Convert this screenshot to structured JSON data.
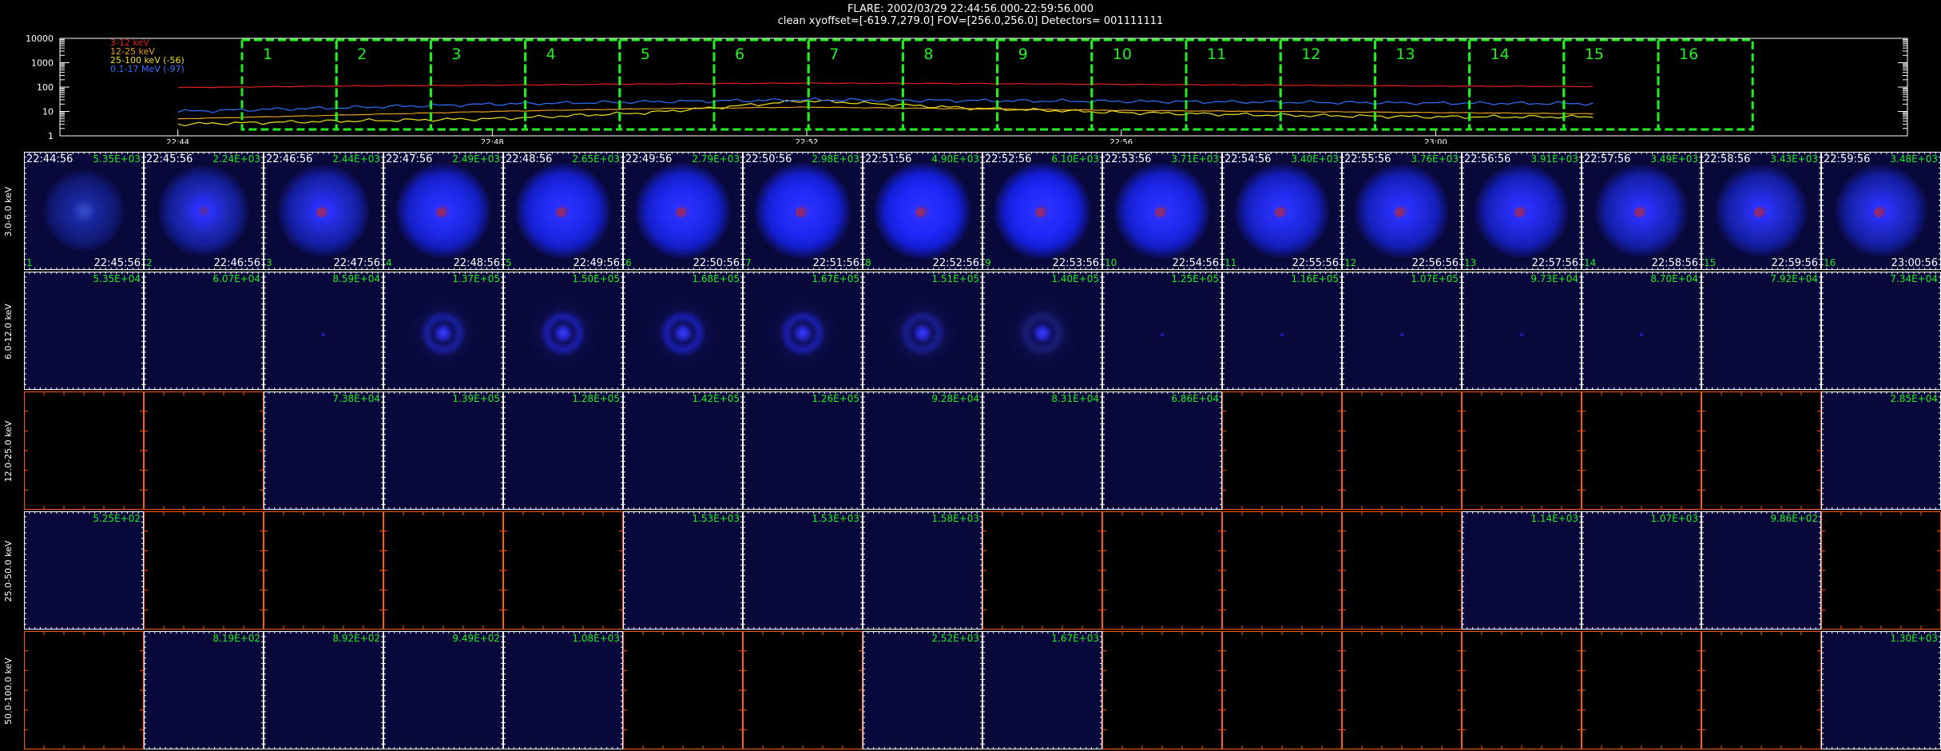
{
  "header": {
    "line1": "FLARE: 2002/03/29 22:44:56.000-22:59:56.000",
    "line2": "clean    xyoffset=[-619.7,279.0]    FOV=[256.0,256.0]    Detectors= 001111111"
  },
  "lightcurve": {
    "y_ticks": [
      "10000",
      "1000",
      "100",
      "10",
      "1"
    ],
    "x_ticks": [
      "22:44",
      "22:48",
      "22:52",
      "22:56",
      "23:00"
    ],
    "legend": [
      {
        "label": "3-12 keV",
        "color": "#e02020"
      },
      {
        "label": "12-25 keV",
        "color": "#e8a020"
      },
      {
        "label": "25-100 keV (-56)",
        "color": "#f0e020"
      },
      {
        "label": "0.1-17 MeV (-97)",
        "color": "#3070ff"
      }
    ],
    "interval_labels": [
      "1",
      "2",
      "3",
      "4",
      "5",
      "6",
      "7",
      "8",
      "9",
      "10",
      "11",
      "12",
      "13",
      "14",
      "15",
      "16"
    ],
    "interval_color": "#22ee22"
  },
  "chart_data": {
    "type": "line",
    "yscale": "log",
    "ylim": [
      1,
      10000
    ],
    "xlim": [
      "22:42:30",
      "23:06:00"
    ],
    "x": [
      "22:44:00",
      "22:46:00",
      "22:48:00",
      "22:50:00",
      "22:52:00",
      "22:54:00",
      "22:56:00",
      "22:58:00",
      "23:00:00",
      "23:02:00"
    ],
    "series": [
      {
        "name": "3-12 keV",
        "color": "#e02020",
        "values": [
          95,
          110,
          120,
          135,
          145,
          140,
          130,
          120,
          110,
          105
        ]
      },
      {
        "name": "12-25 keV",
        "color": "#e8a020",
        "values": [
          5,
          7,
          10,
          13,
          15,
          13,
          11,
          10,
          9,
          8
        ]
      },
      {
        "name": "25-100 keV (-56)",
        "color": "#f0e020",
        "values": [
          3,
          4,
          5,
          9,
          28,
          14,
          9,
          7,
          6,
          6
        ]
      },
      {
        "name": "0.1-17 MeV (-97)",
        "color": "#3070ff",
        "values": [
          10,
          14,
          20,
          25,
          30,
          28,
          26,
          24,
          22,
          21
        ]
      }
    ]
  },
  "grid": {
    "row_labels": [
      "3.0-6.0 keV",
      "6.0-12.0 keV",
      "12.0-25.0 keV",
      "25.0-50.0 keV",
      "50.0-100.0 keV"
    ],
    "start_times": [
      "22:44:56",
      "22:45:56",
      "22:46:56",
      "22:47:56",
      "22:48:56",
      "22:49:56",
      "22:50:56",
      "22:51:56",
      "22:52:56",
      "22:53:56",
      "22:54:56",
      "22:55:56",
      "22:56:56",
      "22:57:56",
      "22:58:56",
      "22:59:56"
    ],
    "end_times": [
      "22:45:56",
      "22:46:56",
      "22:47:56",
      "22:48:56",
      "22:49:56",
      "22:50:56",
      "22:51:56",
      "22:52:56",
      "22:53:56",
      "22:54:56",
      "22:55:56",
      "22:56:56",
      "22:57:56",
      "22:58:56",
      "22:59:56",
      "23:00:56"
    ],
    "peaks": [
      [
        "5.35E+03",
        "2.24E+03",
        "2.44E+03",
        "2.49E+03",
        "2.65E+03",
        "2.79E+03",
        "2.98E+03",
        "4.90E+03",
        "6.10E+03",
        "3.71E+03",
        "3.40E+03",
        "3.76E+03",
        "3.91E+03",
        "3.49E+03",
        "3.43E+03",
        "3.48E+03"
      ],
      [
        "5.35E+04",
        "6.07E+04",
        "8.59E+04",
        "1.37E+05",
        "1.50E+05",
        "1.68E+05",
        "1.67E+05",
        "1.51E+05",
        "1.40E+05",
        "1.25E+05",
        "1.16E+05",
        "1.07E+05",
        "9.73E+04",
        "8.70E+04",
        "7.92E+04",
        "7.34E+04"
      ],
      [
        "",
        "",
        "7.38E+04",
        "1.39E+05",
        "1.28E+05",
        "1.42E+05",
        "1.26E+05",
        "9.28E+04",
        "8.31E+04",
        "6.86E+04",
        "",
        "",
        "",
        "",
        "",
        "2.85E+04"
      ],
      [
        "5.25E+02",
        "",
        "",
        "",
        "",
        "1.53E+03",
        "1.53E+03",
        "1.58E+03",
        "",
        "",
        "",
        "",
        "1.14E+03",
        "1.07E+03",
        "9.86E+02",
        ""
      ],
      [
        "",
        "8.19E+02",
        "8.92E+02",
        "9.49E+02",
        "1.08E+03",
        "",
        "",
        "2.52E+03",
        "1.67E+03",
        "",
        "",
        "",
        "",
        "",
        "",
        "1.30E+03"
      ]
    ],
    "kinds": [
      [
        "s",
        "r",
        "r",
        "r",
        "r",
        "r",
        "r",
        "r",
        "r",
        "r",
        "r",
        "r",
        "r",
        "r",
        "r",
        "r"
      ],
      [
        "t",
        "t",
        "d",
        "c",
        "c",
        "c",
        "c",
        "c",
        "c",
        "d",
        "d",
        "d",
        "d",
        "d",
        "t",
        "t"
      ],
      [
        "b",
        "b",
        "n",
        "n",
        "n",
        "n",
        "n",
        "n",
        "n",
        "n",
        "b",
        "b",
        "b",
        "b",
        "b",
        "n"
      ],
      [
        "n",
        "b",
        "b",
        "b",
        "b",
        "n",
        "n",
        "n",
        "b",
        "b",
        "b",
        "b",
        "n",
        "n",
        "n",
        "b"
      ],
      [
        "b",
        "n",
        "n",
        "n",
        "n",
        "b",
        "b",
        "n",
        "n",
        "b",
        "b",
        "b",
        "b",
        "b",
        "b",
        "n"
      ]
    ],
    "intensity": [
      [
        0.35,
        0.45,
        0.55,
        0.8,
        0.85,
        0.85,
        0.9,
        0.95,
        0.95,
        0.85,
        0.75,
        0.7,
        0.7,
        0.6,
        0.55,
        0.55
      ],
      [
        0.05,
        0.05,
        0.2,
        0.7,
        0.8,
        0.85,
        0.8,
        0.55,
        0.3,
        0.3,
        0.25,
        0.2,
        0.15,
        0.1,
        0.05,
        0.05
      ],
      [
        0,
        0,
        0,
        0,
        0,
        0,
        0,
        0,
        0,
        0,
        0,
        0,
        0,
        0,
        0,
        0
      ],
      [
        0,
        0,
        0,
        0,
        0,
        0,
        0,
        0,
        0,
        0,
        0,
        0,
        0,
        0,
        0,
        0
      ],
      [
        0,
        0,
        0,
        0,
        0,
        0,
        0,
        0,
        0,
        0,
        0,
        0,
        0,
        0,
        0,
        0
      ]
    ],
    "colors": {
      "text_green": "#22ee22",
      "frame_white": "#ffffff",
      "frame_orange": "#ff5a10",
      "panel_blue": "#08083a",
      "panel_black": "#000000"
    }
  }
}
